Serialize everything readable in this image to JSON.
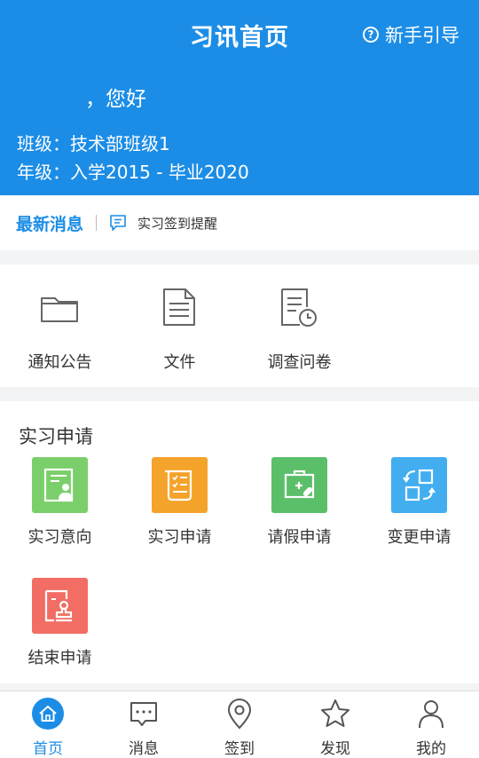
{
  "header": {
    "title": "习讯首页",
    "guide_label": "新手引导",
    "greeting": "，您好",
    "class_line": "班级：技术部班级1",
    "year_line": "年级：入学2015 - 毕业2020"
  },
  "news": {
    "label": "最新消息",
    "text": "实习签到提醒"
  },
  "tools": [
    {
      "label": "通知公告",
      "icon": "folder-icon"
    },
    {
      "label": "文件",
      "icon": "document-icon"
    },
    {
      "label": "调查问卷",
      "icon": "survey-clock-icon"
    }
  ],
  "apply": {
    "title": "实习申请",
    "items": [
      {
        "label": "实习意向",
        "icon": "resume-person-icon",
        "color": "#7bcf6a"
      },
      {
        "label": "实习申请",
        "icon": "scroll-checklist-icon",
        "color": "#f4a32b"
      },
      {
        "label": "请假申请",
        "icon": "medical-kit-icon",
        "color": "#5bbf6a"
      },
      {
        "label": "变更申请",
        "icon": "swap-layout-icon",
        "color": "#42aef0"
      },
      {
        "label": "结束申请",
        "icon": "stamp-icon",
        "color": "#f26d63"
      }
    ]
  },
  "tabs": [
    {
      "label": "首页",
      "icon": "home-icon",
      "active": true
    },
    {
      "label": "消息",
      "icon": "chat-icon"
    },
    {
      "label": "签到",
      "icon": "location-pin-icon"
    },
    {
      "label": "发现",
      "icon": "star-icon"
    },
    {
      "label": "我的",
      "icon": "person-icon"
    }
  ],
  "colors": {
    "primary": "#1c8de6",
    "background": "#f2f4f5"
  }
}
